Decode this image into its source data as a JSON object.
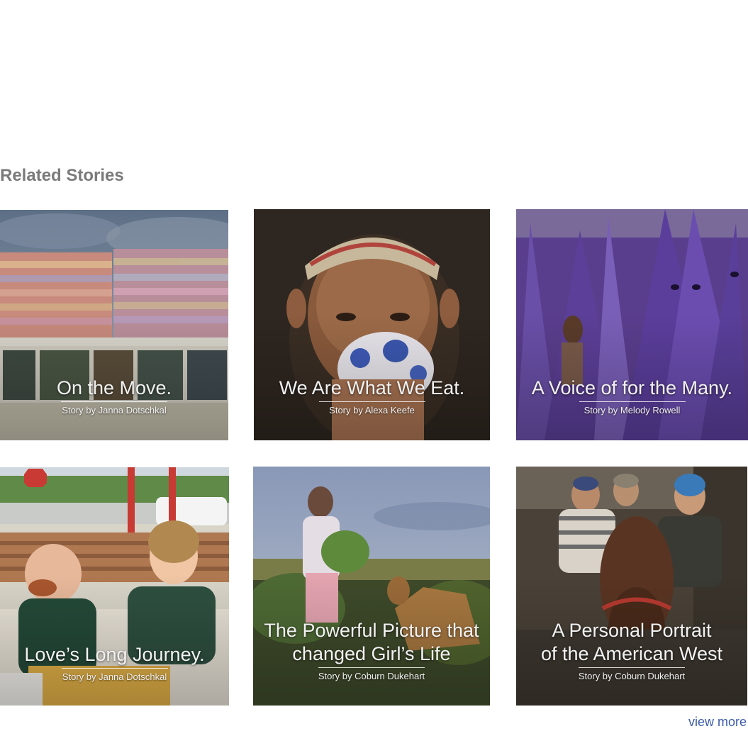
{
  "section": {
    "title": "Related Stories"
  },
  "stories": [
    {
      "title": "On the Move.",
      "byline": "Story by Janna Dotschkal"
    },
    {
      "title": "We Are What We Eat.",
      "byline": "Story by Alexa Keefe"
    },
    {
      "title": "A Voice of for the Many.",
      "byline": "Story by Melody Rowell"
    },
    {
      "title": "Love’s Long Journey.",
      "byline": "Story by Janna Dotschkal"
    },
    {
      "title": "The Powerful Picture that\nchanged  Girl’s Life",
      "byline": "Story by Coburn Dukehart"
    },
    {
      "title": "A Personal Portrait\nof the American West",
      "byline": "Story by Coburn Dukehart"
    }
  ],
  "view_more": "view more",
  "colors": {
    "link": "#3b5ba8",
    "section_title": "#7a7a7a"
  }
}
